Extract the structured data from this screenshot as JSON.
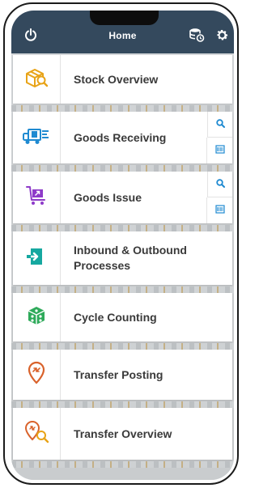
{
  "header": {
    "title": "Home",
    "icons": [
      "power-icon",
      "database-sync-icon",
      "gear-icon"
    ],
    "background_color": "#34495d"
  },
  "tiles": [
    {
      "label": "Stock Overview",
      "icon": "box-search-icon",
      "icon_color": "#e8a317"
    },
    {
      "label": "Goods Receiving",
      "icon": "delivery-truck-icon",
      "icon_color": "#1f8ad1",
      "actions": [
        "search-icon",
        "barcode-scan-icon"
      ]
    },
    {
      "label": "Goods Issue",
      "icon": "cart-box-icon",
      "icon_color": "#8e3bc9",
      "actions": [
        "search-icon",
        "barcode-scan-icon"
      ]
    },
    {
      "label": "Inbound & Outbound Processes",
      "label_line1": "Inbound & Outbound",
      "label_line2": "Processes",
      "icon": "door-enter-icon",
      "icon_color": "#16a8a0"
    },
    {
      "label": "Cycle Counting",
      "icon": "dice-cube-icon",
      "icon_color": "#2eaa5a"
    },
    {
      "label": "Transfer Posting",
      "icon": "location-pin-transfer-icon",
      "icon_color": "#d9622b"
    },
    {
      "label": "Transfer Overview",
      "icon": "transfer-search-icon",
      "icon_color": "#d9622b"
    }
  ],
  "accent_color": "#1f8ad1"
}
